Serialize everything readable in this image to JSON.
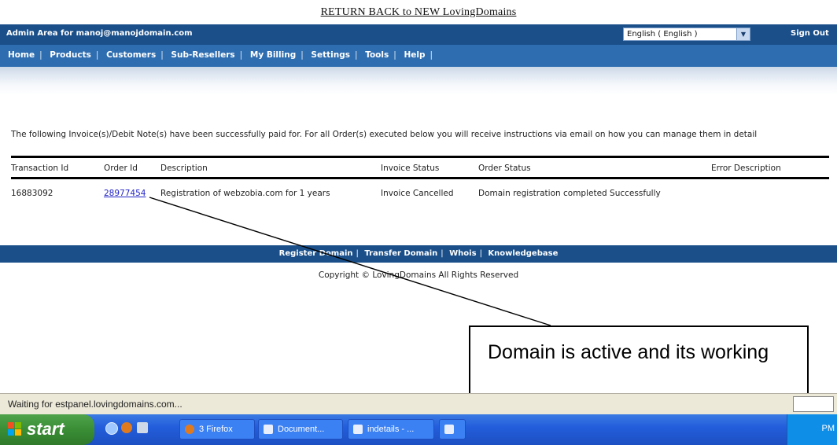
{
  "header": {
    "return_link": "RETURN BACK to NEW LovingDomains"
  },
  "admin_bar": {
    "admin_text": "Admin Area for manoj@manojdomain.com",
    "language": "English ( English )",
    "sign_out": "Sign Out"
  },
  "nav": {
    "items": [
      "Home",
      "Products",
      "Customers",
      "Sub-Resellers",
      "My Billing",
      "Settings",
      "Tools",
      "Help"
    ]
  },
  "main": {
    "message": "The following Invoice(s)/Debit Note(s) have been successfully paid for. For all Order(s) executed below you will receive instructions via email on how you can manage them in detail",
    "table": {
      "headers": [
        "Transaction Id",
        "Order Id",
        "Description",
        "Invoice Status",
        "Order Status",
        "Error Description"
      ],
      "rows": [
        [
          "16883092",
          "28977454",
          "Registration of webzobia.com for 1 years",
          "Invoice Cancelled",
          "Domain registration completed Successfully",
          ""
        ]
      ]
    }
  },
  "footer": {
    "links": [
      "Register Domain",
      "Transfer Domain",
      "Whois",
      "Knowledgebase"
    ],
    "copyright": "Copyright © LovingDomains All Rights Reserved"
  },
  "annotation": {
    "text": "Domain is active and its working"
  },
  "statusbar": {
    "text": "Waiting for estpanel.lovingdomains.com..."
  },
  "taskbar": {
    "start": "start",
    "buttons": [
      "3 Firefox",
      "Document...",
      "indetails - ...",
      ""
    ],
    "clock": "PM"
  },
  "colors": {
    "admin_bar": "#1a4f8a",
    "nav_bar": "#2e6db0",
    "link": "#2323c8",
    "taskbar": "#245edc",
    "start": "#3a8d35"
  }
}
